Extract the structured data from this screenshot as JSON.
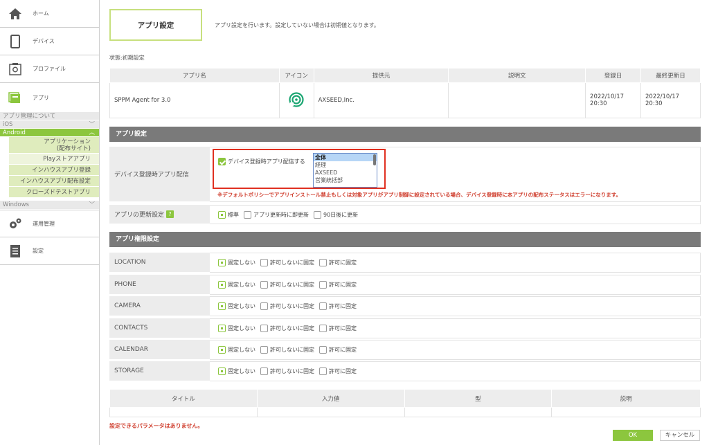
{
  "sidebar": {
    "home": "ホーム",
    "device": "デバイス",
    "profile": "プロファイル",
    "app": "アプリ",
    "app_manage_about": "アプリ管理について",
    "ios": "iOS",
    "android": "Android",
    "android_items": [
      "アプリケーション(配布サイト)",
      "Playストアアプリ",
      "インハウスアプリ登録",
      "インハウスアプリ配布設定",
      "クローズドテストアプリ"
    ],
    "windows": "Windows",
    "operation": "運用管理",
    "settings": "設定"
  },
  "header": {
    "tab_title": "アプリ設定",
    "tab_desc": "アプリ設定を行います。設定していない場合は初期値となります。",
    "state": "状態:初期設定"
  },
  "app_table": {
    "headers": [
      "アプリ名",
      "アイコン",
      "提供元",
      "説明文",
      "登録日",
      "最終更新日"
    ],
    "row": {
      "name": "SPPM Agent for 3.0",
      "provider": "AXSEED,Inc.",
      "desc": "",
      "registered_date": "2022/10/17",
      "registered_time": "20:30",
      "updated_date": "2022/10/17",
      "updated_time": "20:30"
    }
  },
  "app_settings": {
    "section": "アプリ設定",
    "distribute_label": "デバイス登録時アプリ配信",
    "distribute_checkbox": "デバイス登録時アプリ配信する",
    "groups": [
      "全体",
      "経理",
      "AXSEED",
      "営業統括部"
    ],
    "warning": "※デフォルトポリシーでアプリインストール禁止もしくは対象アプリがアプリ制御に設定されている場合、デバイス登録時に本アプリの配布ステータスはエラーになります。",
    "update_label": "アプリの更新設定",
    "update_help": "?",
    "update_options": [
      "標準",
      "アプリ更新時に即更新",
      "90日後に更新"
    ]
  },
  "permissions": {
    "section": "アプリ権限設定",
    "rows": [
      "LOCATION",
      "PHONE",
      "CAMERA",
      "CONTACTS",
      "CALENDAR",
      "STORAGE"
    ],
    "options": [
      "固定しない",
      "許可しないに固定",
      "許可に固定"
    ]
  },
  "params": {
    "headers": [
      "タイトル",
      "入力値",
      "型",
      "説明"
    ],
    "empty_message": "設定できるパラメータはありません。"
  },
  "buttons": {
    "ok": "OK",
    "cancel": "キャンセル"
  },
  "colors": {
    "accent": "#8cc63e",
    "section": "#7a7a7a",
    "warning": "#d04030"
  }
}
